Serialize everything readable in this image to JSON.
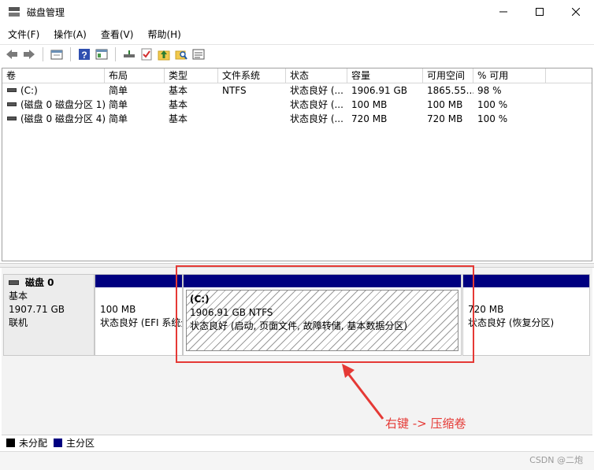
{
  "window": {
    "title": "磁盘管理",
    "icon": "disk-management-icon"
  },
  "menu": [
    "文件(F)",
    "操作(A)",
    "查看(V)",
    "帮助(H)"
  ],
  "toolbar": {
    "icons": [
      "back-arrow-icon",
      "forward-arrow-icon",
      "console-icon",
      "help-icon",
      "properties-icon",
      "connect-icon",
      "check-icon",
      "up-folder-icon",
      "search-folder-icon",
      "list-icon"
    ]
  },
  "volume_table": {
    "columns": [
      "卷",
      "布局",
      "类型",
      "文件系统",
      "状态",
      "容量",
      "可用空间",
      "% 可用",
      ""
    ],
    "rows": [
      [
        "(C:)",
        "简单",
        "基本",
        "NTFS",
        "状态良好 (...",
        "1906.91 GB",
        "1865.55...",
        "98 %"
      ],
      [
        "(磁盘 0 磁盘分区 1)",
        "简单",
        "基本",
        "",
        "状态良好 (...",
        "100 MB",
        "100 MB",
        "100 %"
      ],
      [
        "(磁盘 0 磁盘分区 4)",
        "简单",
        "基本",
        "",
        "状态良好 (...",
        "720 MB",
        "720 MB",
        "100 %"
      ]
    ]
  },
  "disk": {
    "name": "磁盘 0",
    "type": "基本",
    "size": "1907.71 GB",
    "status": "联机",
    "partitions": [
      {
        "title": "",
        "size": "100 MB",
        "status": "状态良好 (EFI 系统分区)"
      },
      {
        "title": "(C:)",
        "size": "1906.91 GB NTFS",
        "status": "状态良好 (启动, 页面文件, 故障转储, 基本数据分区)"
      },
      {
        "title": "",
        "size": "720 MB",
        "status": "状态良好 (恢复分区)"
      }
    ]
  },
  "annotation": "右键 -> 压缩卷",
  "legend": [
    {
      "label": "未分配",
      "color": "#000000"
    },
    {
      "label": "主分区",
      "color": "#000080"
    }
  ],
  "colors": {
    "partition_bar": "#000080",
    "highlight": "#e53935"
  },
  "watermark": "CSDN @二炮"
}
